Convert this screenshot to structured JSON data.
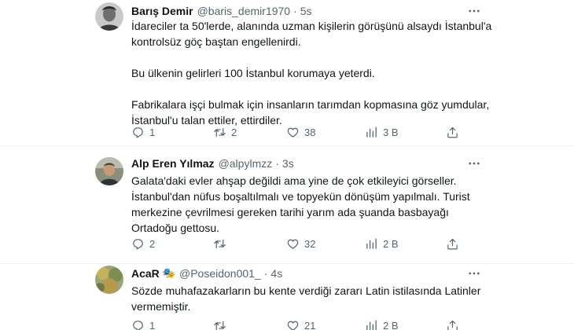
{
  "tweets": [
    {
      "name": "Barış Demir",
      "handle": "@baris_demir1970",
      "time": "5s",
      "paragraphs": [
        "İdareciler ta 50'lerde, alanında uzman kişilerin görüşünü alsaydı İstanbul'a kontrolsüz göç baştan engellenirdi.",
        "Bu ülkenin gelirleri 100 İstanbul korumaya yeterdi.",
        "Fabrikalara işçi bulmak için insanların tarımdan kopmasına göz yumdular, İstanbul'u talan ettiler, ettirdiler."
      ],
      "replies": "1",
      "retweets": "2",
      "likes": "38",
      "views": "3 B"
    },
    {
      "name": "Alp Eren Yılmaz",
      "handle": "@alpylmzz",
      "time": "3s",
      "paragraphs": [
        "Galata'daki evler ahşap değildi ama yine de çok etkileyici görseller. İstanbul'dan nüfus boşaltılmalı ve topyekün dönüşüm yapılmalı. Turist merkezine çevrilmesi gereken tarihi yarım ada şuanda basbayağı Ortadoğu gettosu."
      ],
      "replies": "2",
      "retweets": "",
      "likes": "32",
      "views": "2 B"
    },
    {
      "name": "AcaR",
      "badge": "🎭",
      "handle": "@Poseidon001_",
      "time": "4s",
      "paragraphs": [
        "Sözde muhafazakarların bu kente verdiği zararı Latin istilasında Latinler vermemiştir."
      ],
      "replies": "1",
      "retweets": "",
      "likes": "21",
      "views": "2 B"
    }
  ],
  "icons": {
    "reply": "reply-icon",
    "retweet": "retweet-icon",
    "like": "heart-icon",
    "views": "views-chart-icon",
    "share": "share-icon",
    "more": "more-options-icon"
  },
  "colors": {
    "text": "#0f1419",
    "secondary": "#536471",
    "divider": "#eff3f4"
  }
}
